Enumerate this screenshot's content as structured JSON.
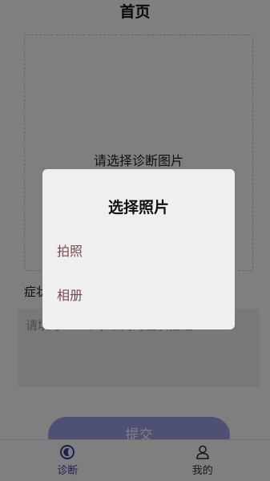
{
  "header": {
    "title": "首页"
  },
  "photo": {
    "hint": "请选择诊断图片"
  },
  "symptom": {
    "label": "症状",
    "placeholder": "请填写100个字以内的症状描述"
  },
  "submit": {
    "label": "提交"
  },
  "tabbar": {
    "tabs": [
      {
        "label": "诊断",
        "icon": "diagnosis-icon",
        "active": true
      },
      {
        "label": "我的",
        "icon": "user-icon",
        "active": false
      }
    ]
  },
  "dialog": {
    "title": "选择照片",
    "options": [
      {
        "label": "拍照"
      },
      {
        "label": "相册"
      }
    ]
  },
  "colors": {
    "accent": "#3d3fa3",
    "option_text": "#7a4a4a",
    "dialog_bg": "#efefef",
    "button": "#9fa3e8"
  }
}
